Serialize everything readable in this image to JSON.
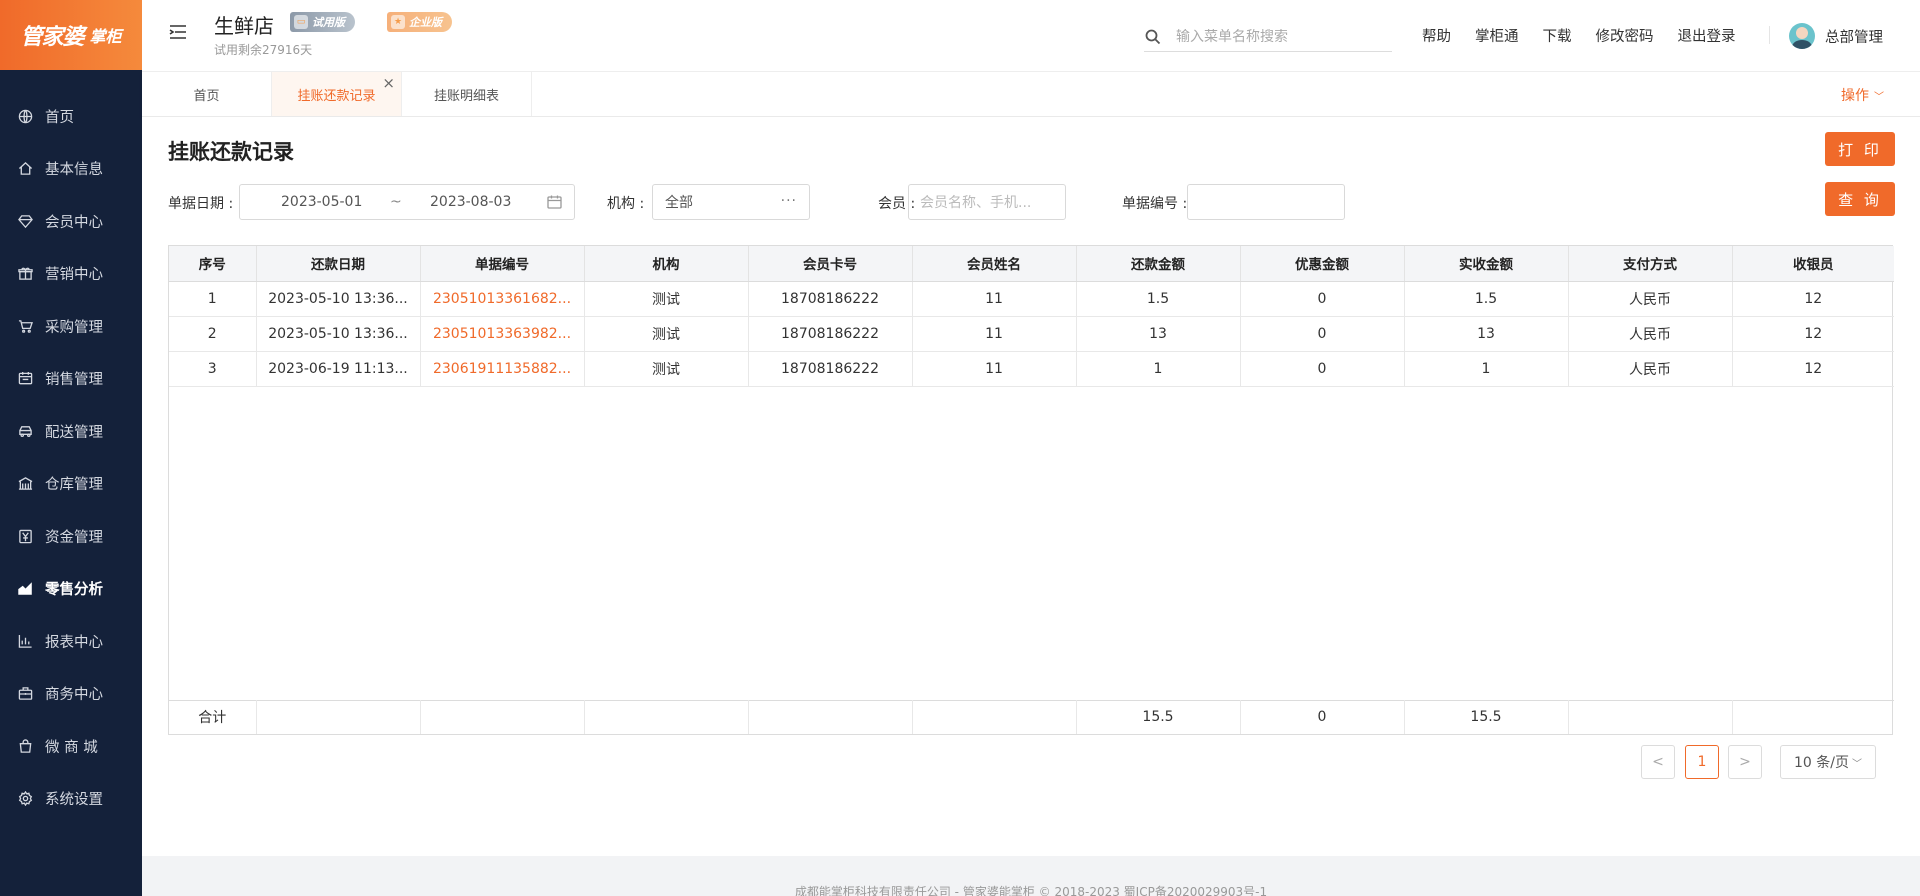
{
  "brand": {
    "logo_main": "管家婆",
    "logo_sub": "掌柜"
  },
  "sidebar": {
    "items": [
      {
        "label": "首页",
        "icon": "globe-icon"
      },
      {
        "label": "基本信息",
        "icon": "home-icon"
      },
      {
        "label": "会员中心",
        "icon": "diamond-icon"
      },
      {
        "label": "营销中心",
        "icon": "gift-icon"
      },
      {
        "label": "采购管理",
        "icon": "cart-icon"
      },
      {
        "label": "销售管理",
        "icon": "calendar-icon"
      },
      {
        "label": "配送管理",
        "icon": "car-icon"
      },
      {
        "label": "仓库管理",
        "icon": "warehouse-icon"
      },
      {
        "label": "资金管理",
        "icon": "money-icon"
      },
      {
        "label": "零售分析",
        "icon": "analytics-icon",
        "active": true
      },
      {
        "label": "报表中心",
        "icon": "bar-chart-icon"
      },
      {
        "label": "商务中心",
        "icon": "briefcase-icon"
      },
      {
        "label": "微 商 城",
        "icon": "shopping-bag-icon"
      },
      {
        "label": "系统设置",
        "icon": "gear-icon"
      }
    ]
  },
  "header": {
    "shop_name": "生鲜店",
    "badge_trial": "试用版",
    "badge_enterprise": "企业版",
    "trial_remaining": "试用剩余27916天",
    "search_placeholder": "输入菜单名称搜索",
    "links": [
      "帮助",
      "掌柜通",
      "下载",
      "修改密码",
      "退出登录"
    ],
    "user_name": "总部管理"
  },
  "tabs": [
    {
      "label": "首页"
    },
    {
      "label": "挂账还款记录",
      "active": true
    },
    {
      "label": "挂账明细表"
    }
  ],
  "ops_label": "操作",
  "page": {
    "title": "挂账还款记录",
    "print_button": "打 印",
    "query_button": "查 询"
  },
  "filters": {
    "date_label": "单据日期 :",
    "date_start": "2023-05-01",
    "date_sep": "~",
    "date_end": "2023-08-03",
    "org_label": "机构 :",
    "org_value": "全部",
    "org_more": "···",
    "member_label": "会员 :",
    "member_placeholder": "会员名称、手机...",
    "docno_label": "单据编号 :"
  },
  "table": {
    "columns": [
      "序号",
      "还款日期",
      "单据编号",
      "机构",
      "会员卡号",
      "会员姓名",
      "还款金额",
      "优惠金额",
      "实收金额",
      "支付方式",
      "收银员"
    ],
    "rows": [
      [
        "1",
        "2023-05-10 13:36...",
        "23051013361682...",
        "测试",
        "18708186222",
        "11",
        "1.5",
        "0",
        "1.5",
        "人民币",
        "12"
      ],
      [
        "2",
        "2023-05-10 13:36...",
        "23051013363982...",
        "测试",
        "18708186222",
        "11",
        "13",
        "0",
        "13",
        "人民币",
        "12"
      ],
      [
        "3",
        "2023-06-19 11:13...",
        "23061911135882...",
        "测试",
        "18708186222",
        "11",
        "1",
        "0",
        "1",
        "人民币",
        "12"
      ]
    ],
    "summary": [
      "合计",
      "",
      "",
      "",
      "",
      "",
      "15.5",
      "0",
      "15.5",
      "",
      ""
    ]
  },
  "pager": {
    "prev": "<",
    "current": "1",
    "next": ">",
    "page_size": "10 条/页"
  },
  "footer": {
    "text": "成都能掌柜科技有限责任公司 - 管家婆能掌柜 © 2018-2023 蜀ICP备2020029903号-1"
  },
  "colors": {
    "accent": "#f06a2a",
    "sidebar_bg": "#14213a"
  }
}
